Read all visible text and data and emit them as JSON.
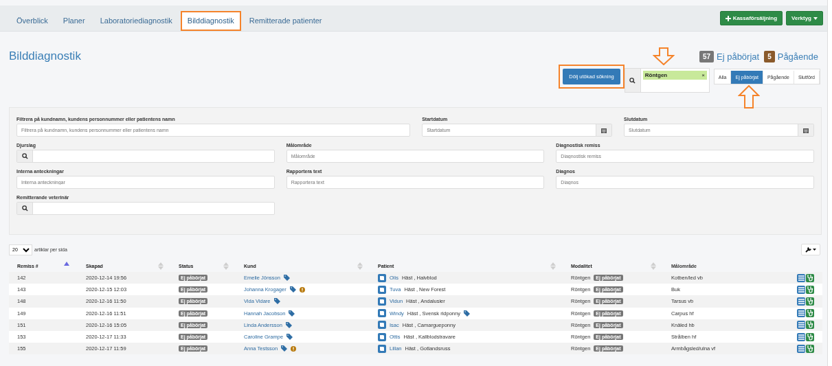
{
  "nav": {
    "tabs": [
      {
        "label": "Överblick",
        "selected": false,
        "highlighted": false
      },
      {
        "label": "Planer",
        "selected": false,
        "highlighted": false
      },
      {
        "label": "Laboratoriediagnostik",
        "selected": false,
        "highlighted": false
      },
      {
        "label": "Bilddiagnostik",
        "selected": true,
        "highlighted": true
      },
      {
        "label": "Remitterade patienter",
        "selected": false,
        "highlighted": false
      }
    ],
    "buttons": [
      {
        "label": "Kassaförsäljning",
        "kind": "add"
      },
      {
        "label": "Verktyg",
        "kind": "dropdown"
      }
    ]
  },
  "page_title": "Bilddiagnostik",
  "counters": [
    {
      "count": "57",
      "label": "Ej påbörjat",
      "color": "#777777"
    },
    {
      "count": "5",
      "label": "Pågående",
      "color": "#8a5a2b"
    }
  ],
  "toggle_search_button": {
    "label": "Dölj utökad sökning",
    "highlighted": true
  },
  "search_tags": [
    {
      "label": "Röntgen",
      "remove": "×",
      "pointed": true
    }
  ],
  "status_filter": [
    {
      "label": "Alla",
      "selected": false,
      "pointed": false
    },
    {
      "label": "Ej påbörjat",
      "selected": true,
      "pointed": true
    },
    {
      "label": "Pågående",
      "selected": false,
      "pointed": false
    },
    {
      "label": "Slutförd",
      "selected": false,
      "pointed": false
    }
  ],
  "filters": [
    {
      "label": "Filtrera på kundnamn, kundens personnummer eller patientens namn",
      "placeholder": "Filtrera på kundnamn, kundens personnummer eller patientens namn",
      "kind": "text"
    },
    {
      "label": "Startdatum",
      "placeholder": "Startdatum",
      "kind": "date"
    },
    {
      "label": "Slutdatum",
      "placeholder": "Slutdatum",
      "kind": "date"
    },
    {
      "label": "Djurslag",
      "kind": "search"
    },
    {
      "label": "Målområde",
      "placeholder": "Målområde",
      "kind": "text"
    },
    {
      "label": "Diagnostisk remiss",
      "placeholder": "Diagnostisk remiss",
      "kind": "text"
    },
    {
      "label": "Interna anteckningar",
      "placeholder": "Interna anteckningar",
      "kind": "text"
    },
    {
      "label": "Rapportera text",
      "placeholder": "Rapportera text",
      "kind": "text"
    },
    {
      "label": "Diagnos",
      "placeholder": "Diagnos",
      "kind": "text"
    },
    {
      "label": "Remitterande veterinär",
      "kind": "search"
    }
  ],
  "page_size": {
    "value": "20",
    "label": "artiklar per sida"
  },
  "table": {
    "columns": [
      {
        "label": "Remiss #",
        "kind": "sortable",
        "sorted": true
      },
      {
        "label": "Skapad",
        "kind": "sortable",
        "sorted": false
      },
      {
        "label": "Status",
        "kind": "sortable",
        "sorted": false
      },
      {
        "label": "Kund",
        "kind": "sortable",
        "sorted": false
      },
      {
        "label": "Patient",
        "kind": "sortable",
        "sorted": false
      },
      {
        "label": "Modalitet",
        "kind": "sortable",
        "sorted": false
      },
      {
        "label": "Målområde",
        "kind": "plain",
        "sorted": false
      }
    ],
    "rows": [
      {
        "remiss": "142",
        "skapad": "2020-12-14 19:56",
        "status": "Ej påbörjat",
        "kund": "Emelie Jönsson",
        "warning": false,
        "patient": "Olis",
        "patient_info": "Häst , Halvblod",
        "patient_tag": false,
        "modalitet": "Röntgen",
        "modalitet_status": "Ej påbörjat",
        "malomrade": "Kotben/led vb"
      },
      {
        "remiss": "143",
        "skapad": "2020-12-15 12:03",
        "status": "Ej påbörjat",
        "kund": "Johanna Krogager",
        "warning": true,
        "patient": "Tuva",
        "patient_info": "Häst , New Forest",
        "patient_tag": false,
        "modalitet": "Röntgen",
        "modalitet_status": "Ej påbörjat",
        "malomrade": "Buk"
      },
      {
        "remiss": "148",
        "skapad": "2020-12-16 11:50",
        "status": "Ej påbörjat",
        "kund": "Vida Vidare",
        "warning": false,
        "patient": "Vidun",
        "patient_info": "Häst , Andalusier",
        "patient_tag": false,
        "modalitet": "Röntgen",
        "modalitet_status": "Ej påbörjat",
        "malomrade": "Tarsus vb"
      },
      {
        "remiss": "149",
        "skapad": "2020-12-16 11:51",
        "status": "Ej påbörjat",
        "kund": "Hannah Jacobson",
        "warning": false,
        "patient": "Windy",
        "patient_info": "Häst , Svensk ridponny",
        "patient_tag": true,
        "modalitet": "Röntgen",
        "modalitet_status": "Ej påbörjat",
        "malomrade": "Carpus hf"
      },
      {
        "remiss": "151",
        "skapad": "2020-12-16 15:05",
        "status": "Ej påbörjat",
        "kund": "Linda Andersson",
        "warning": false,
        "patient": "Isac",
        "patient_info": "Häst , Camargueponny",
        "patient_tag": false,
        "modalitet": "Röntgen",
        "modalitet_status": "Ej påbörjat",
        "malomrade": "Knäled hb"
      },
      {
        "remiss": "153",
        "skapad": "2020-12-17 11:33",
        "status": "Ej påbörjat",
        "kund": "Caroline Grampe",
        "warning": false,
        "patient": "Ottis",
        "patient_info": "Häst , Kallblodstravare",
        "patient_tag": false,
        "modalitet": "Röntgen",
        "modalitet_status": "Ej påbörjat",
        "malomrade": "Strålben hf"
      },
      {
        "remiss": "155",
        "skapad": "2020-12-17 11:59",
        "status": "Ej påbörjat",
        "kund": "Anna Testsson",
        "warning": true,
        "patient": "Lillan",
        "patient_info": "Häst , Gotlandsruss",
        "patient_tag": false,
        "modalitet": "Röntgen",
        "modalitet_status": "Ej påbörjat",
        "malomrade": "Armbågsled/ulna vf"
      }
    ]
  }
}
